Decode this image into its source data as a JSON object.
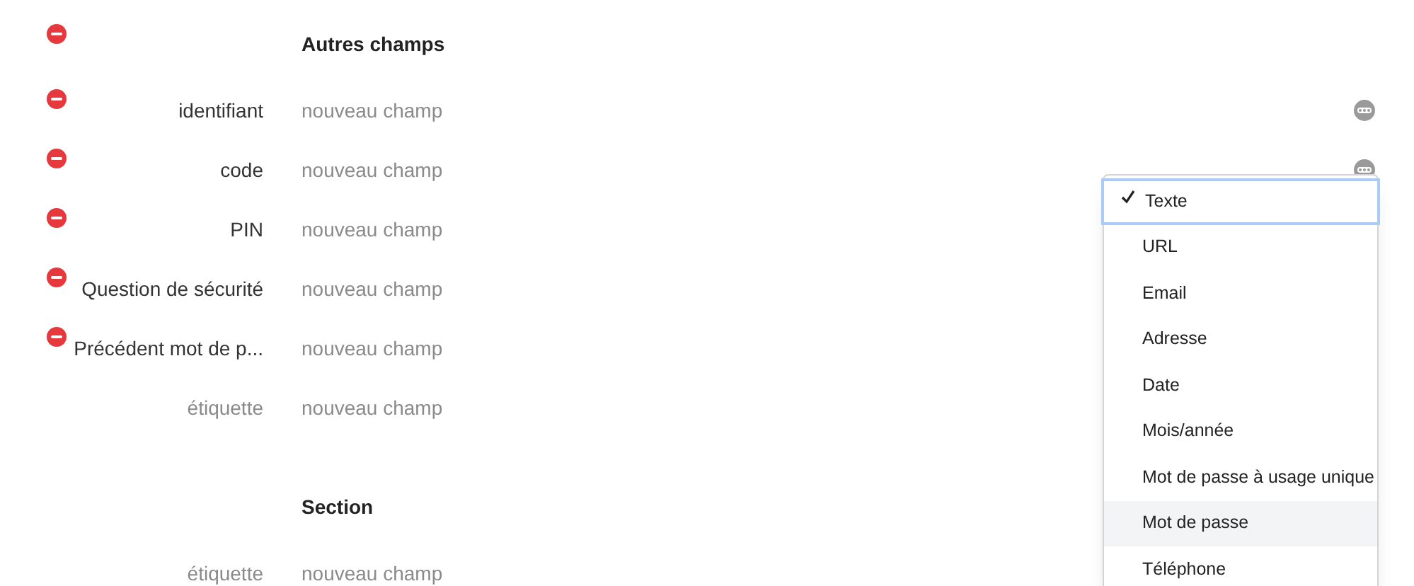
{
  "sections": [
    {
      "title": "Autres champs",
      "removable": true,
      "rows": [
        {
          "label": "identifiant",
          "label_is_placeholder": false,
          "value_placeholder": "nouveau champ",
          "removable": true,
          "options_button": true
        },
        {
          "label": "code",
          "label_is_placeholder": false,
          "value_placeholder": "nouveau champ",
          "removable": true,
          "options_button": true
        },
        {
          "label": "PIN",
          "label_is_placeholder": false,
          "value_placeholder": "nouveau champ",
          "removable": true,
          "options_button": false
        },
        {
          "label": "Question de sécurité",
          "label_is_placeholder": false,
          "value_placeholder": "nouveau champ",
          "removable": true,
          "options_button": false
        },
        {
          "label": "Précédent mot de p...",
          "label_is_placeholder": false,
          "value_placeholder": "nouveau champ",
          "removable": true,
          "options_button": false
        },
        {
          "label": "étiquette",
          "label_is_placeholder": true,
          "value_placeholder": "nouveau champ",
          "removable": false,
          "options_button": false
        }
      ]
    },
    {
      "title": "Section",
      "removable": false,
      "rows": [
        {
          "label": "étiquette",
          "label_is_placeholder": true,
          "value_placeholder": "nouveau champ",
          "removable": false,
          "options_button": false
        }
      ]
    }
  ],
  "type_menu": {
    "items": [
      {
        "label": "Texte",
        "selected": true,
        "hovered": false
      },
      {
        "label": "URL",
        "selected": false,
        "hovered": false
      },
      {
        "label": "Email",
        "selected": false,
        "hovered": false
      },
      {
        "label": "Adresse",
        "selected": false,
        "hovered": false
      },
      {
        "label": "Date",
        "selected": false,
        "hovered": false
      },
      {
        "label": "Mois/année",
        "selected": false,
        "hovered": false
      },
      {
        "label": "Mot de passe à usage unique",
        "selected": false,
        "hovered": false
      },
      {
        "label": "Mot de passe",
        "selected": false,
        "hovered": true
      },
      {
        "label": "Téléphone",
        "selected": false,
        "hovered": false
      }
    ]
  }
}
